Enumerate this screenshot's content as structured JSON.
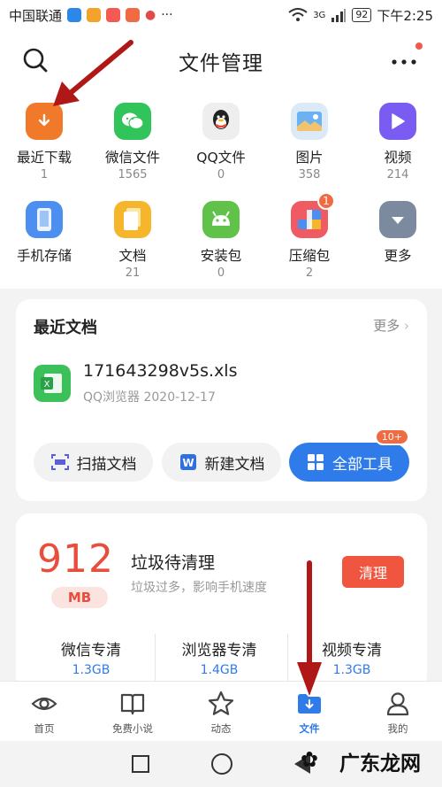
{
  "status": {
    "carrier": "中国联通",
    "battery": "92",
    "time": "下午2:25",
    "signal": "3G"
  },
  "header": {
    "title": "文件管理"
  },
  "categories": [
    {
      "label": "最近下载",
      "count": "1",
      "icon": "download-icon",
      "color": "#f07a2a"
    },
    {
      "label": "微信文件",
      "count": "1565",
      "icon": "wechat-icon",
      "color": "#31c45b"
    },
    {
      "label": "QQ文件",
      "count": "0",
      "icon": "qq-icon",
      "color": "#eeeeee"
    },
    {
      "label": "图片",
      "count": "358",
      "icon": "image-icon",
      "color": "#dceaf8"
    },
    {
      "label": "视频",
      "count": "214",
      "icon": "video-icon",
      "color": "#7a5cf2"
    },
    {
      "label": "手机存储",
      "count": "",
      "icon": "phone-storage-icon",
      "color": "#4d8ff0"
    },
    {
      "label": "文档",
      "count": "21",
      "icon": "document-icon",
      "color": "#f6b62c"
    },
    {
      "label": "安装包",
      "count": "0",
      "icon": "android-icon",
      "color": "#61c24a"
    },
    {
      "label": "压缩包",
      "count": "2",
      "icon": "archive-icon",
      "color": "#f05a62",
      "badge": "1"
    },
    {
      "label": "更多",
      "count": "",
      "icon": "more-down-icon",
      "color": "#7c8aa0"
    }
  ],
  "recent": {
    "title": "最近文档",
    "more": "更多",
    "file": {
      "name": "171643298v5s.xls",
      "meta": "QQ浏览器  2020-12-17"
    },
    "tools": {
      "scan": "扫描文档",
      "new": "新建文档",
      "all": "全部工具",
      "badge": "10+"
    }
  },
  "cleanup": {
    "size": "912",
    "unit": "MB",
    "title": "垃圾待清理",
    "desc": "垃圾过多，影响手机速度",
    "button": "清理",
    "options": [
      {
        "label": "微信专清",
        "size": "1.3GB"
      },
      {
        "label": "浏览器专清",
        "size": "1.4GB"
      },
      {
        "label": "视频专清",
        "size": "1.3GB"
      }
    ]
  },
  "nav": [
    {
      "label": "首页",
      "icon": "eye-icon"
    },
    {
      "label": "免费小说",
      "icon": "book-icon"
    },
    {
      "label": "动态",
      "icon": "star-icon"
    },
    {
      "label": "文件",
      "icon": "folder-icon",
      "active": true
    },
    {
      "label": "我的",
      "icon": "profile-icon"
    }
  ],
  "watermark": "广东龙网",
  "colors": {
    "accent_blue": "#2f7bea",
    "danger_red": "#e84d3d",
    "arrow_red": "#b01818"
  }
}
